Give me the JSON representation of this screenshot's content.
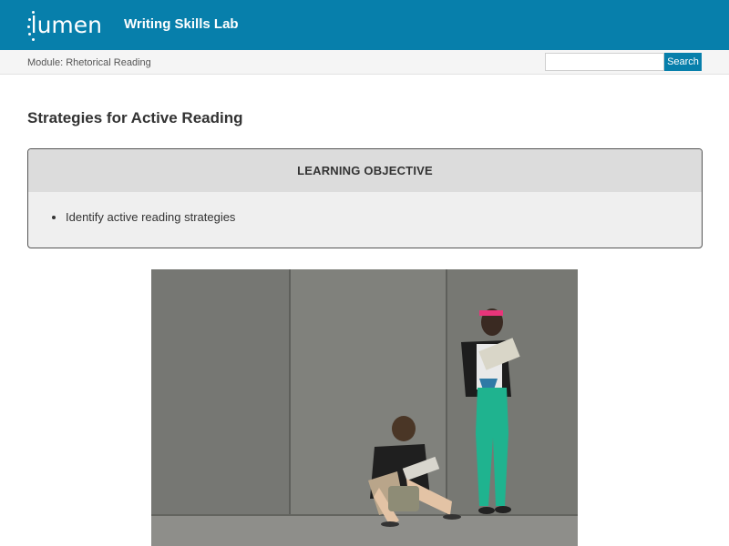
{
  "header": {
    "logo_text": "lumen",
    "book_title": "Writing Skills Lab",
    "brand_color": "#077fab"
  },
  "subheader": {
    "module": "Module: Rhetorical Reading",
    "search_placeholder": "",
    "search_button": "Search"
  },
  "main": {
    "title": "Strategies for Active Reading",
    "objective_heading": "LEARNING OBJECTIVE",
    "objectives": [
      "Identify active reading strategies"
    ]
  },
  "image": {
    "subject": "two-students-reading-against-gray-wall",
    "icon": "photo"
  }
}
